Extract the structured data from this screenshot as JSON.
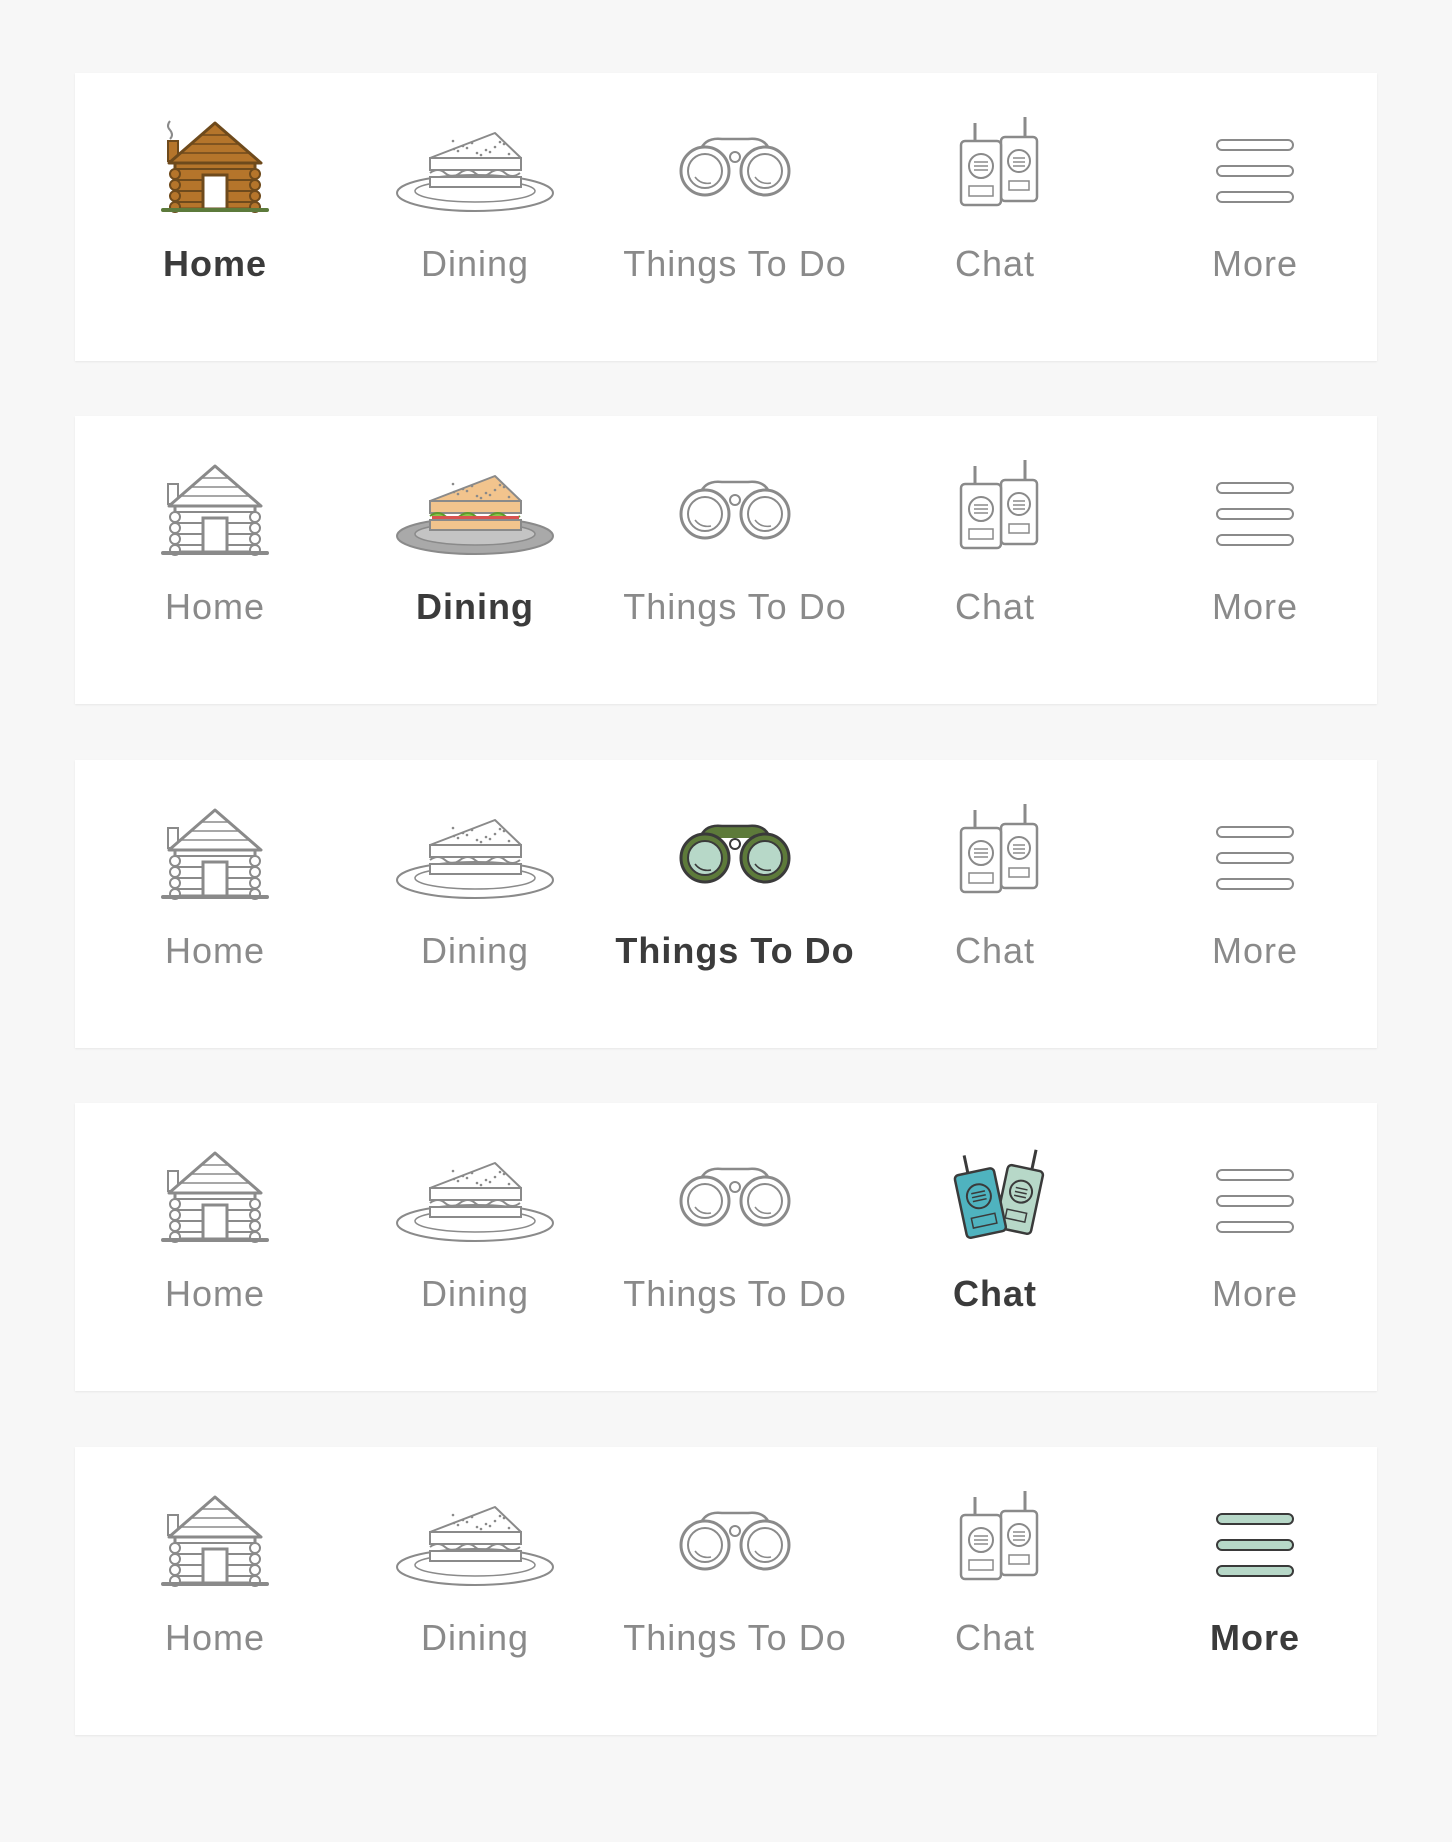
{
  "labels": [
    "Home",
    "Dining",
    "Things To Do",
    "Chat",
    "More"
  ],
  "icons": [
    "cabin-icon",
    "sandwich-icon",
    "binoculars-icon",
    "walkie-talkie-icon",
    "menu-icon"
  ],
  "navbars": [
    {
      "active_index": 0,
      "items": [
        {
          "label": "Home",
          "icon": "cabin-icon",
          "active": true
        },
        {
          "label": "Dining",
          "icon": "sandwich-icon",
          "active": false
        },
        {
          "label": "Things To Do",
          "icon": "binoculars-icon",
          "active": false
        },
        {
          "label": "Chat",
          "icon": "walkie-talkie-icon",
          "active": false
        },
        {
          "label": "More",
          "icon": "menu-icon",
          "active": false
        }
      ]
    },
    {
      "active_index": 1,
      "items": [
        {
          "label": "Home",
          "icon": "cabin-icon",
          "active": false
        },
        {
          "label": "Dining",
          "icon": "sandwich-icon",
          "active": true
        },
        {
          "label": "Things To Do",
          "icon": "binoculars-icon",
          "active": false
        },
        {
          "label": "Chat",
          "icon": "walkie-talkie-icon",
          "active": false
        },
        {
          "label": "More",
          "icon": "menu-icon",
          "active": false
        }
      ]
    },
    {
      "active_index": 2,
      "items": [
        {
          "label": "Home",
          "icon": "cabin-icon",
          "active": false
        },
        {
          "label": "Dining",
          "icon": "sandwich-icon",
          "active": false
        },
        {
          "label": "Things To Do",
          "icon": "binoculars-icon",
          "active": true
        },
        {
          "label": "Chat",
          "icon": "walkie-talkie-icon",
          "active": false
        },
        {
          "label": "More",
          "icon": "menu-icon",
          "active": false
        }
      ]
    },
    {
      "active_index": 3,
      "items": [
        {
          "label": "Home",
          "icon": "cabin-icon",
          "active": false
        },
        {
          "label": "Dining",
          "icon": "sandwich-icon",
          "active": false
        },
        {
          "label": "Things To Do",
          "icon": "binoculars-icon",
          "active": false
        },
        {
          "label": "Chat",
          "icon": "walkie-talkie-icon",
          "active": true
        },
        {
          "label": "More",
          "icon": "menu-icon",
          "active": false
        }
      ]
    },
    {
      "active_index": 4,
      "items": [
        {
          "label": "Home",
          "icon": "cabin-icon",
          "active": false
        },
        {
          "label": "Dining",
          "icon": "sandwich-icon",
          "active": false
        },
        {
          "label": "Things To Do",
          "icon": "binoculars-icon",
          "active": false
        },
        {
          "label": "Chat",
          "icon": "walkie-talkie-icon",
          "active": false
        },
        {
          "label": "More",
          "icon": "menu-icon",
          "active": true
        }
      ]
    }
  ],
  "colors": {
    "background": "#f7f7f7",
    "bar": "#ffffff",
    "inactive_label": "#8a8a8a",
    "active_label": "#3b3b3b",
    "outline": "#888888",
    "cabin": "#b5752b",
    "cabin_ground": "#5c7a3b",
    "bread": "#f2c48d",
    "lettuce": "#8bc34a",
    "tomato": "#d9534f",
    "plate": "#a9a9a9",
    "binocular_body": "#5d7a3a",
    "binocular_lens": "#b7d8c8",
    "radio_front": "#4fb3bf",
    "radio_back": "#b7d8c8",
    "menu_active": "#b7d8c8"
  }
}
